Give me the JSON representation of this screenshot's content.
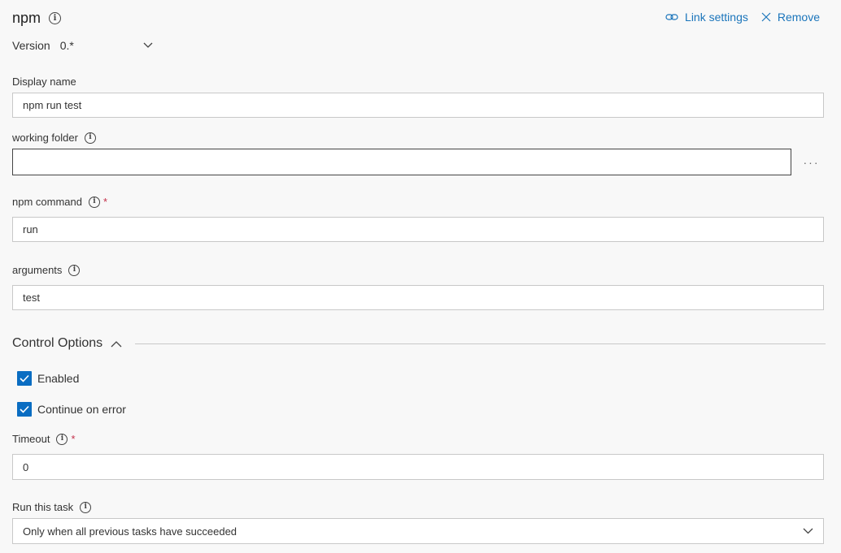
{
  "header": {
    "title": "npm",
    "link_settings": "Link settings",
    "remove": "Remove"
  },
  "version": {
    "label": "Version",
    "value": "0.*"
  },
  "fields": {
    "display_name": {
      "label": "Display name",
      "value": "npm run test"
    },
    "working_folder": {
      "label": "working folder",
      "value": "",
      "browse": "···"
    },
    "npm_command": {
      "label": "npm command",
      "required": "*",
      "value": "run"
    },
    "arguments": {
      "label": "arguments",
      "value": "test"
    }
  },
  "control_options": {
    "title": "Control Options",
    "enabled": {
      "label": "Enabled",
      "checked": true
    },
    "continue_on_error": {
      "label": "Continue on error",
      "checked": true
    },
    "timeout": {
      "label": "Timeout",
      "required": "*",
      "value": "0"
    },
    "run_this_task": {
      "label": "Run this task",
      "value": "Only when all previous tasks have succeeded"
    }
  },
  "icons": {
    "info": "info-icon",
    "link": "link-icon",
    "close": "close-icon",
    "chevron_down": "chevron-down-icon",
    "chevron_up": "chevron-up-icon",
    "check": "check-icon"
  },
  "colors": {
    "accent": "#1b75bb",
    "checkbox": "#0a6dc2",
    "required": "#c4314b",
    "background": "#f8f8f8"
  }
}
